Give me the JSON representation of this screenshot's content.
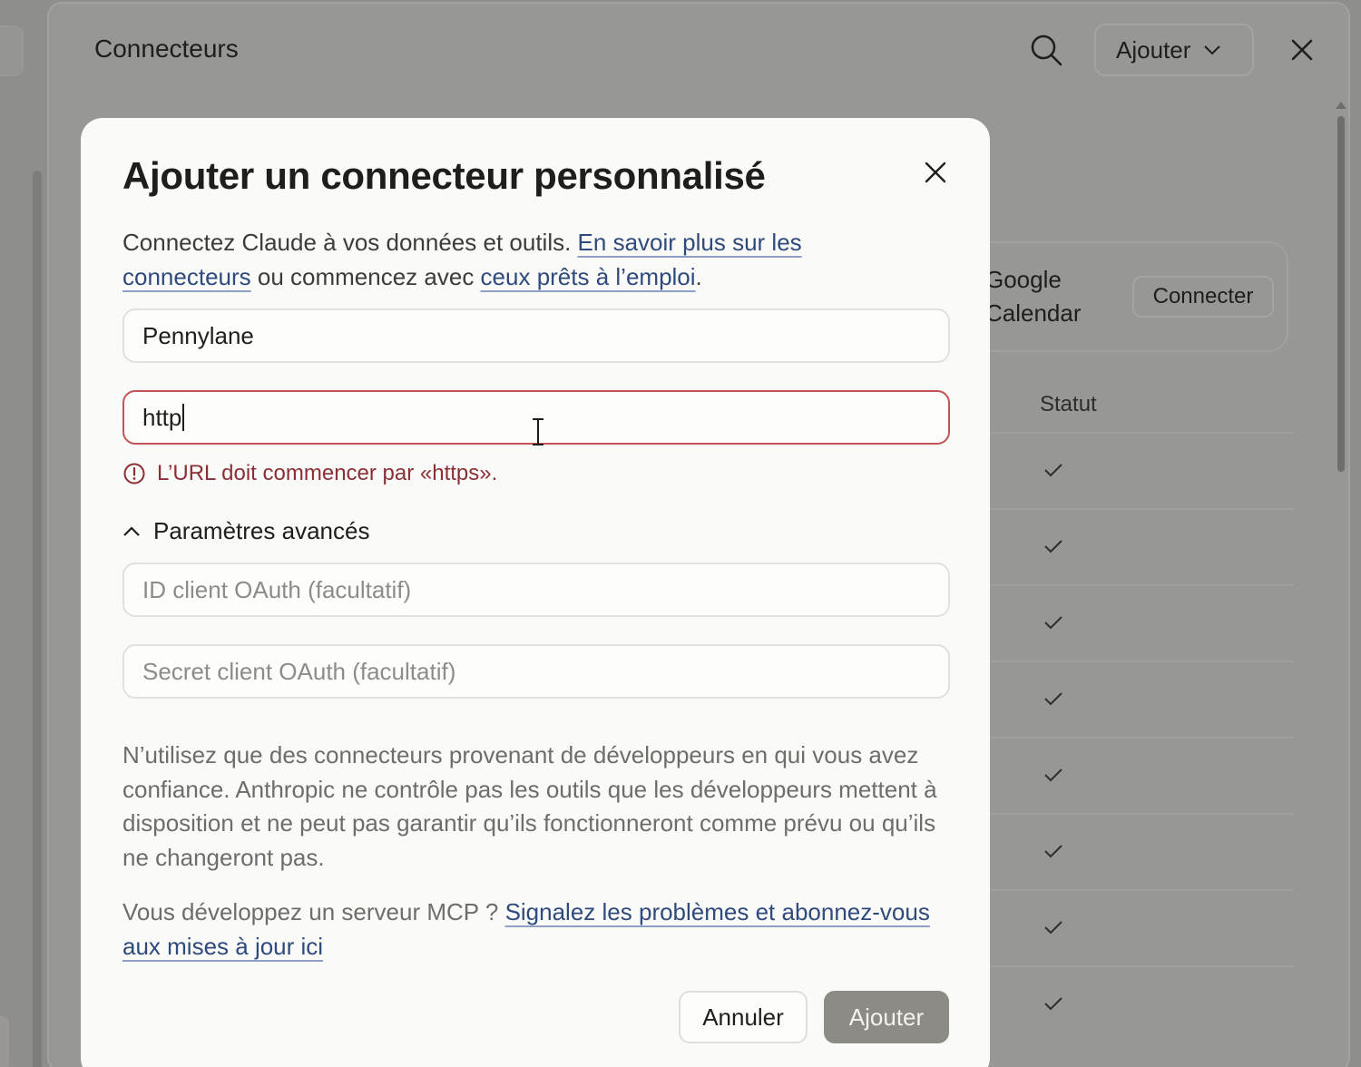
{
  "background": {
    "header_title": "Connecteurs",
    "add_button_label": "Ajouter",
    "card": {
      "name_line1": "Google",
      "name_line2": "Calendar",
      "connect_label": "Connecter"
    },
    "table": {
      "status_header": "Statut",
      "rows": 8
    }
  },
  "modal": {
    "title": "Ajouter un connecteur personnalisé",
    "intro": {
      "text_before": "Connectez Claude à vos données et outils. ",
      "link_learn_more": "En savoir plus sur les connecteurs",
      "text_middle": " ou commencez avec ",
      "link_ready": "ceux prêts à l’emploi",
      "text_after": "."
    },
    "name_field": {
      "value": "Pennylane"
    },
    "url_field": {
      "value": "http"
    },
    "url_error": "L’URL doit commencer par «https».",
    "advanced_toggle_label": "Paramètres avancés",
    "oauth_id_field": {
      "placeholder": "ID client OAuth (facultatif)"
    },
    "oauth_secret_field": {
      "placeholder": "Secret client OAuth (facultatif)"
    },
    "disclaimer": "N’utilisez que des connecteurs provenant de développeurs en qui vous avez confiance. Anthropic ne contrôle pas les outils que les développeurs mettent à disposition et ne peut pas garantir qu’ils fonctionneront comme prévu ou qu’ils ne changeront pas.",
    "mcp": {
      "text": "Vous développez un serveur MCP ? ",
      "link": "Signalez les problèmes et abonnez-vous aux mises à jour ici"
    },
    "cancel_label": "Annuler",
    "add_label": "Ajouter"
  },
  "colors": {
    "overlay": "#8e8e8b",
    "modal_bg": "#fafaf8",
    "link": "#2f4a7d",
    "error": "#8b2f35",
    "error_border": "#c45357",
    "disabled_button": "#8c8b86"
  }
}
